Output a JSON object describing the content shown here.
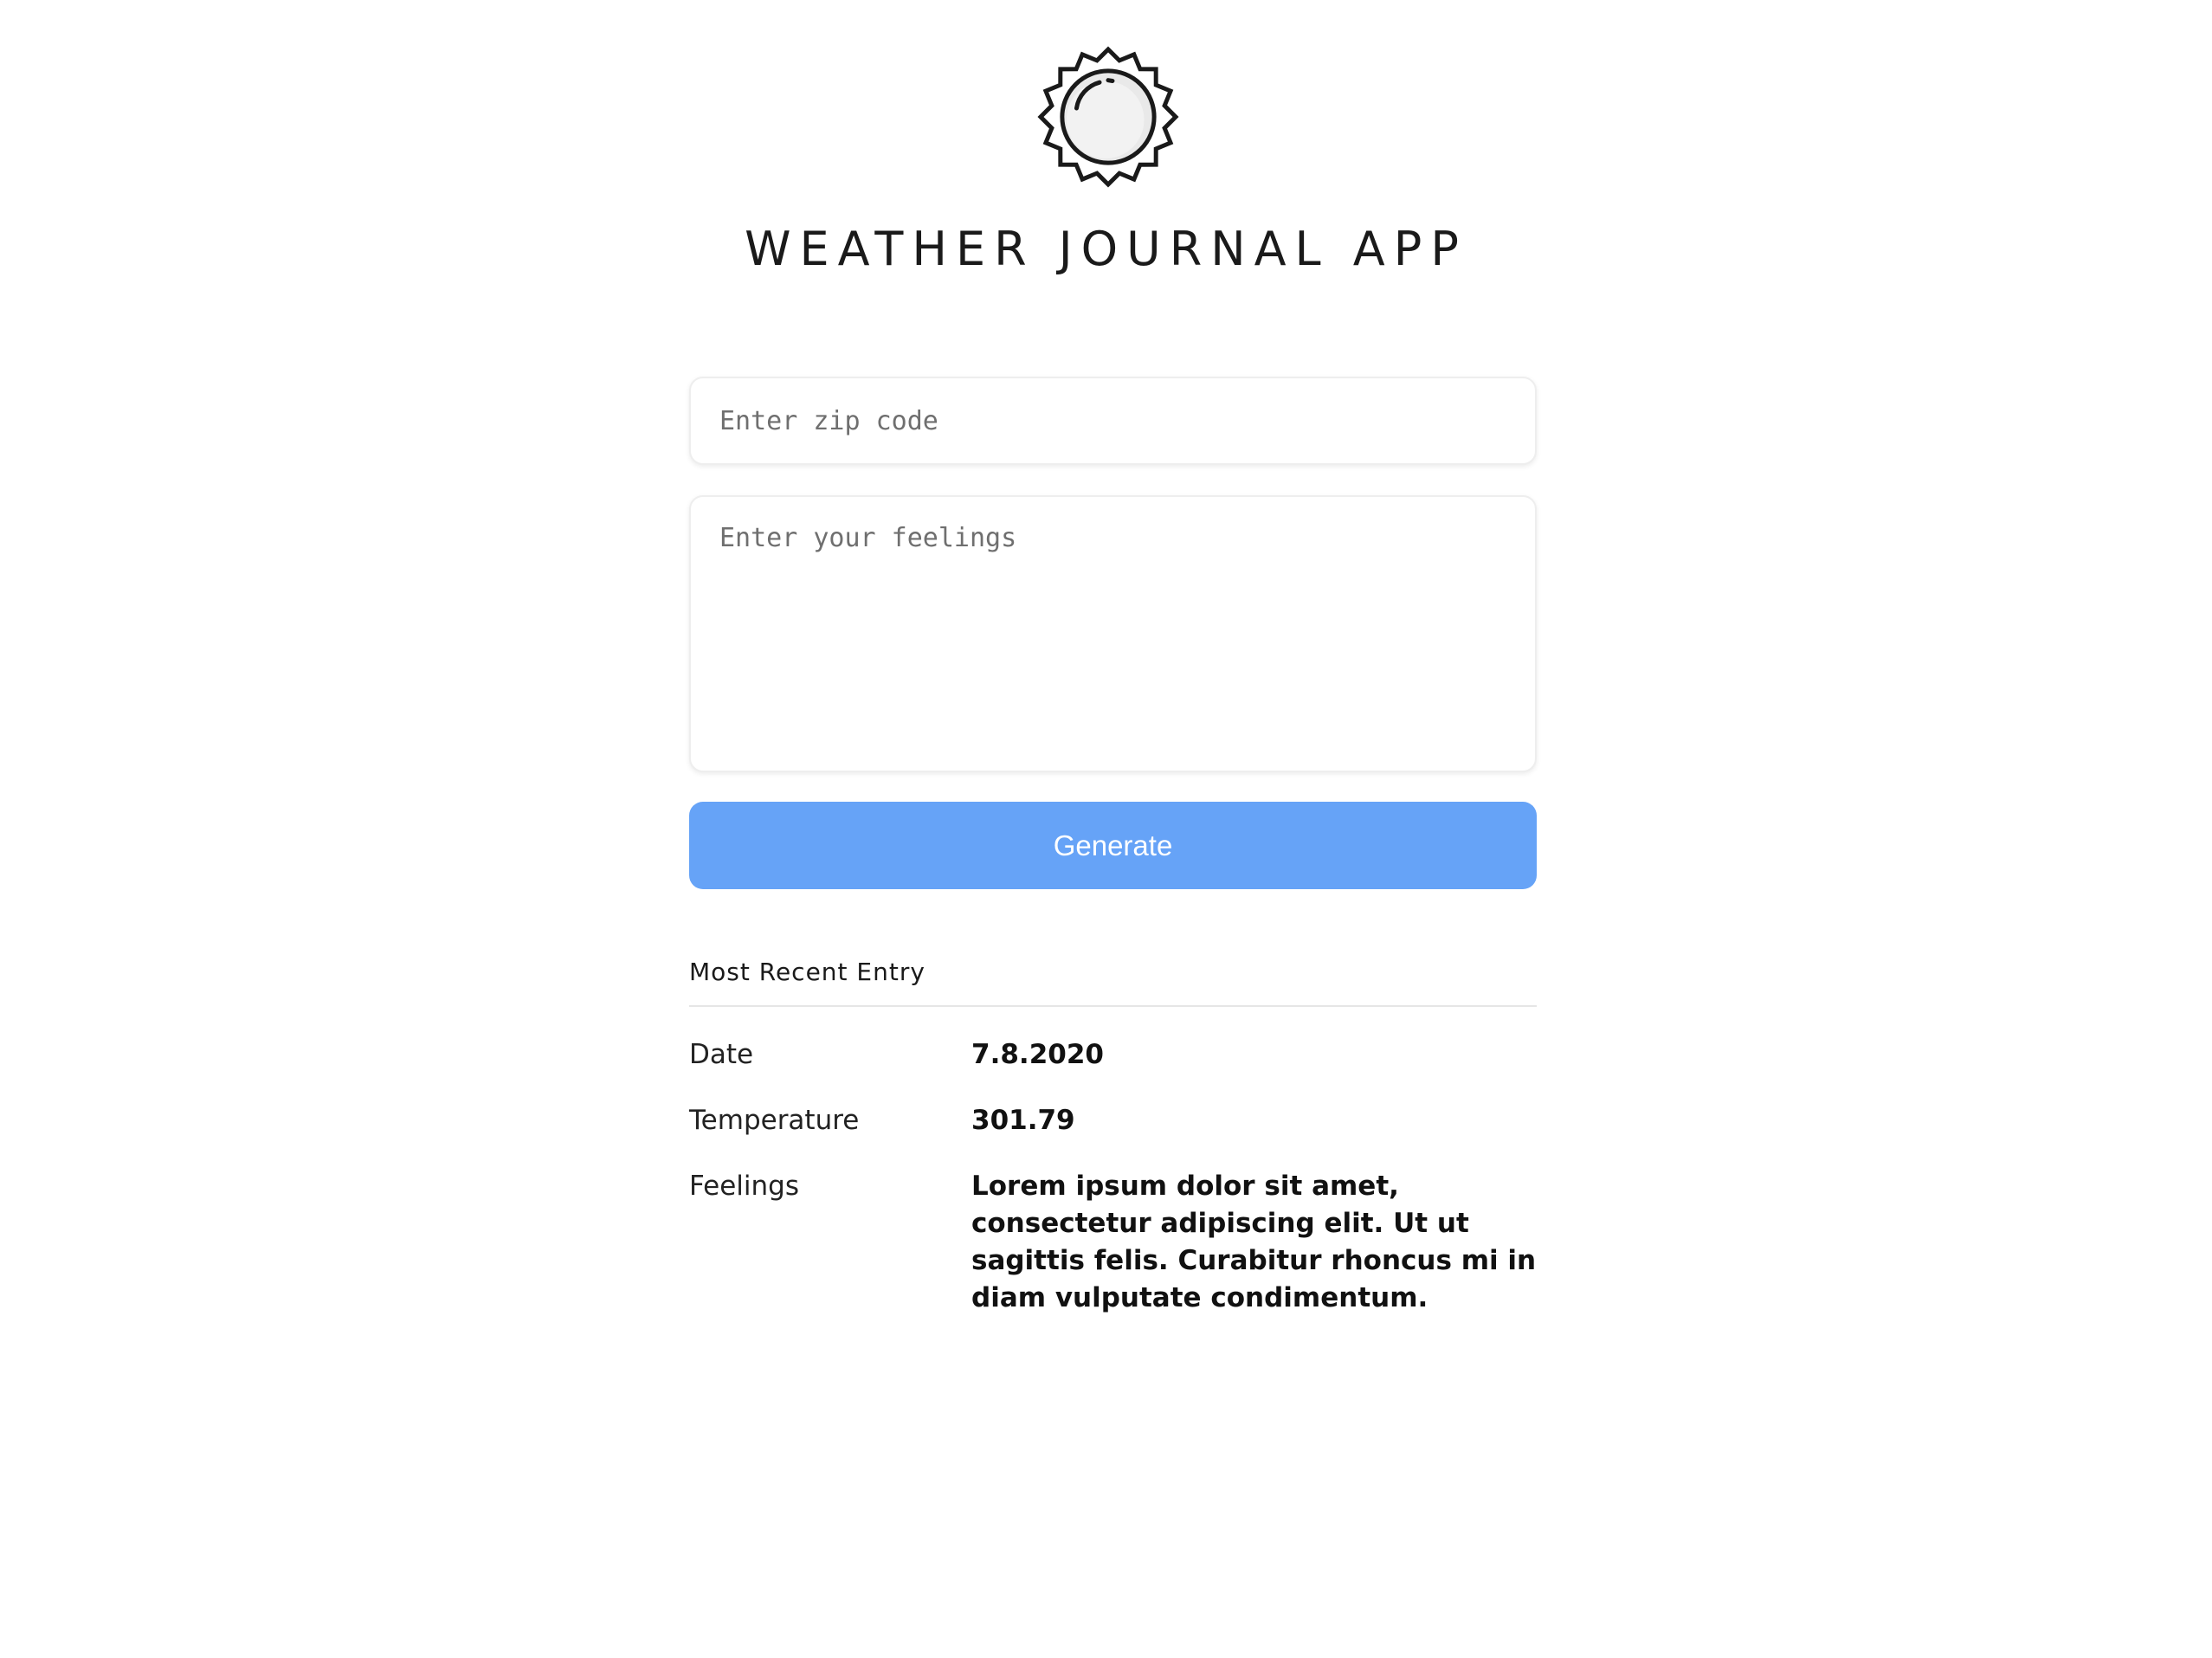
{
  "app": {
    "title": "WEATHER JOURNAL APP",
    "logo_icon": "sun-icon"
  },
  "form": {
    "zip_placeholder": "Enter zip code",
    "zip_value": "",
    "feelings_placeholder": "Enter your feelings",
    "feelings_value": "",
    "generate_label": "Generate"
  },
  "entry": {
    "heading": "Most Recent Entry",
    "date_label": "Date",
    "date_value": "7.8.2020",
    "temp_label": "Temperature",
    "temp_value": "301.79",
    "feelings_label": "Feelings",
    "feelings_value": "Lorem ipsum dolor sit amet, consectetur adipiscing elit. Ut ut sagittis felis. Curabitur rhoncus mi in diam vulputate condimentum."
  },
  "colors": {
    "button": "#66a3f7",
    "button_text": "#ffffff",
    "text": "#1a1a1a"
  }
}
